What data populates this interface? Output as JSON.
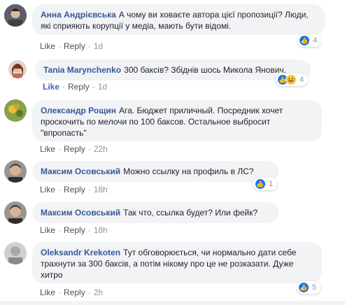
{
  "comments": [
    {
      "author": "Анна Андрієвська",
      "text": "А чому ви ховаєте автора цієї пропозиції? Люди, які сприяють корупції у медіа, мають бути відомі.",
      "like": "Like",
      "reply": "Reply",
      "time": "1d",
      "reaction_count": "4",
      "reactions": [
        "like-icon"
      ],
      "avatar_color": "#6b6f7a"
    },
    {
      "author": "Tania Marynchenko",
      "text": "300 баксів? Збіднів шось Микола Янович.",
      "like": "Like",
      "reply": "Reply",
      "time": "1d",
      "reaction_count": "4",
      "reactions": [
        "like-icon",
        "haha-icon"
      ],
      "avatar_color": "#b5795a"
    },
    {
      "author": "Олександр Рощин",
      "text": "Ага. Бюджет приличный. Посредник хочет проскочить по мелочи по 100 баксов. Остальное выбросит \"впропасть\"",
      "like": "Like",
      "reply": "Reply",
      "time": "22h",
      "avatar_color": "#7a8b3a"
    },
    {
      "author": "Максим Осовський",
      "text": "Можно ссылку на профиль в ЛС?",
      "like": "Like",
      "reply": "Reply",
      "time": "18h",
      "reaction_count": "1",
      "reactions": [
        "like-icon"
      ],
      "avatar_color": "#8a7a6a"
    },
    {
      "author": "Максим Осовський",
      "text": "Так что, ссылка будет? Или фейк?",
      "like": "Like",
      "reply": "Reply",
      "time": "18h",
      "avatar_color": "#8a7a6a"
    },
    {
      "author": "Oleksandr Krekoten",
      "text": "Тут обговорюється, чи нормально дати себе трахнути за 300 баксів, а потім нікому про це не розказати. Дуже хитро",
      "like": "Like",
      "reply": "Reply",
      "time": "2h",
      "reaction_count": "5",
      "reactions": [
        "like-icon"
      ],
      "avatar_color": "#c9c9c9"
    }
  ],
  "colors": {
    "author": "#385898",
    "bubble_bg": "#f2f3f5",
    "like_blue": "#1877f2",
    "like_active": "#4267b2"
  }
}
